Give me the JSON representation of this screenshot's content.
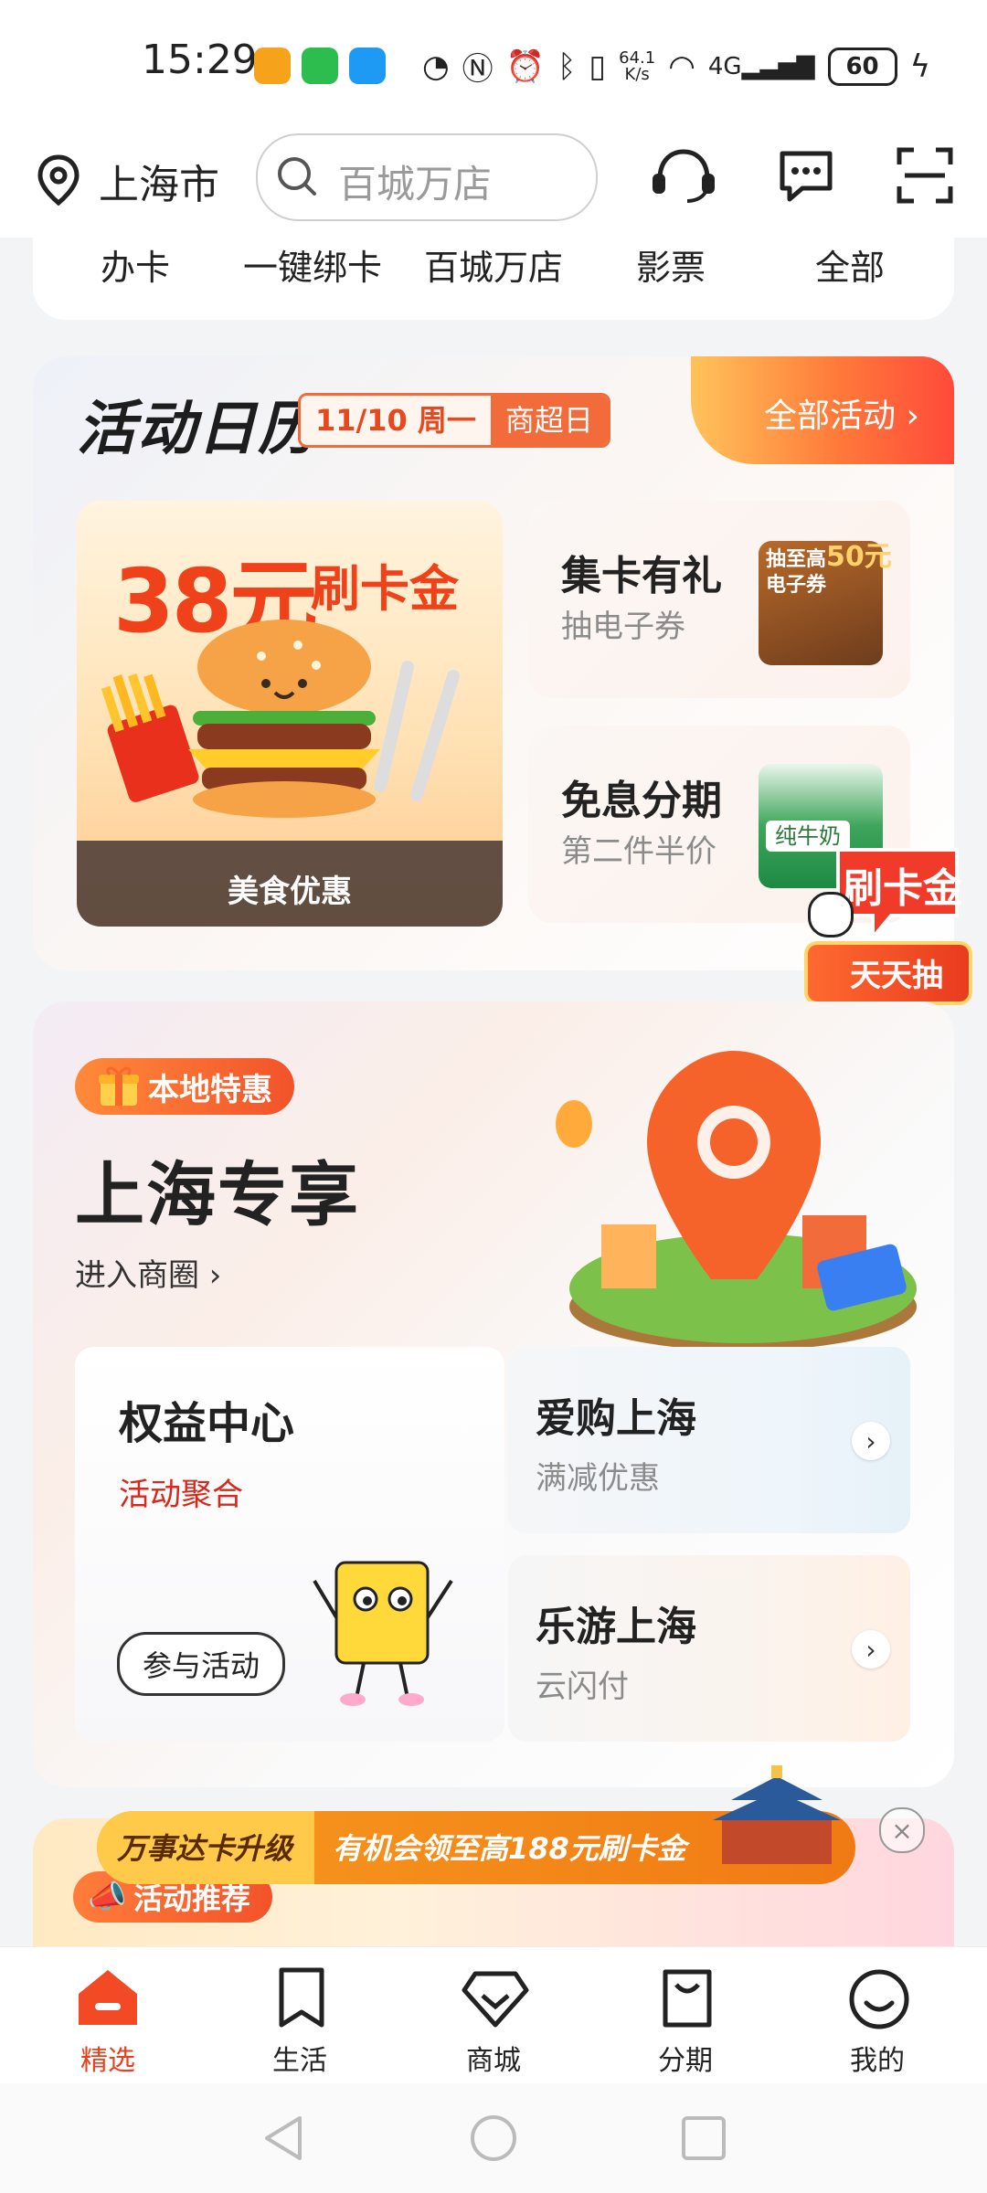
{
  "status_bar": {
    "time": "15:29",
    "net_speed": "64.1\nK/s",
    "battery": "60"
  },
  "header": {
    "city": "上海市",
    "search_placeholder": "百城万店"
  },
  "quick_nav": [
    "办卡",
    "一键绑卡",
    "百城万店",
    "影票",
    "全部"
  ],
  "calendar": {
    "title": "活动日历",
    "date": "11/10 周一",
    "day_theme": "商超日",
    "all_label": "全部活动",
    "promo": {
      "amount": "38元",
      "type": "刷卡金",
      "footer": "美食优惠"
    },
    "tiles": [
      {
        "title": "集卡有礼",
        "subtitle": "抽电子券",
        "thumb_text_top": "抽至高",
        "thumb_text_big": "50元",
        "thumb_text_bottom": "电子券"
      },
      {
        "title": "免息分期",
        "subtitle": "第二件半价",
        "thumb_text": "纯牛奶"
      }
    ],
    "float_badge": "刷卡金",
    "float_sub": "天天抽"
  },
  "local": {
    "badge": "本地特惠",
    "title": "上海专享",
    "enter_link": "进入商圈",
    "rights": {
      "title": "权益中心",
      "subtitle": "活动聚合",
      "button": "参与活动"
    },
    "cards": [
      {
        "title": "爱购上海",
        "subtitle": "满减优惠"
      },
      {
        "title": "乐游上海",
        "subtitle": "云闪付"
      }
    ]
  },
  "recommend": {
    "badge": "活动推荐"
  },
  "banner": {
    "left": "万事达卡升级",
    "right": "有机会领至高188元刷卡金"
  },
  "tabs": [
    {
      "label": "精选",
      "icon": "home-icon",
      "active": true
    },
    {
      "label": "生活",
      "icon": "bookmark-icon",
      "active": false
    },
    {
      "label": "商城",
      "icon": "diamond-icon",
      "active": false
    },
    {
      "label": "分期",
      "icon": "bag-icon",
      "active": false
    },
    {
      "label": "我的",
      "icon": "smile-icon",
      "active": false
    }
  ],
  "colors": {
    "accent": "#e8401c",
    "orange": "#f26b3a"
  }
}
